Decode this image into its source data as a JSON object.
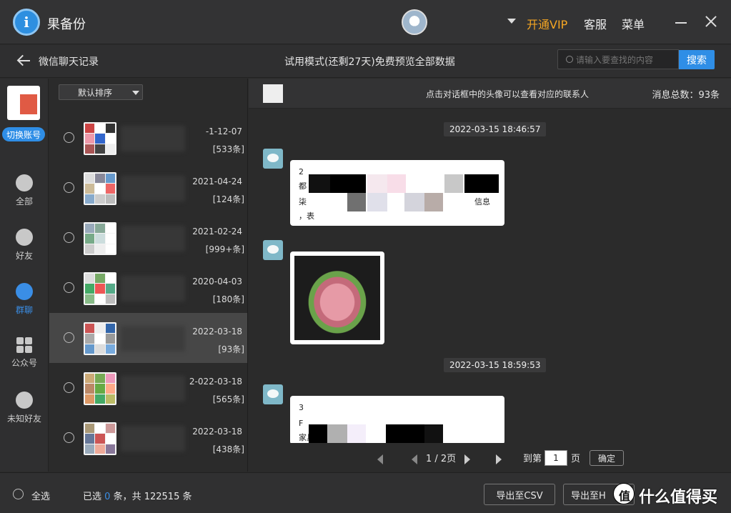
{
  "app": {
    "name": "果备份",
    "vip": "开通VIP",
    "service": "客服",
    "menu": "菜单"
  },
  "subbar": {
    "title": "微信聊天记录",
    "trial": "试用模式(还剩27天)免费预览全部数据",
    "search_placeholder": "请输入要查找的内容",
    "search_button": "搜索"
  },
  "leftnav": {
    "switch_label": "切换账号",
    "items": [
      {
        "label": "全部",
        "icon": "grid-icon"
      },
      {
        "label": "好友",
        "icon": "person-icon"
      },
      {
        "label": "群聊",
        "icon": "group-icon"
      },
      {
        "label": "公众号",
        "icon": "apps-icon"
      },
      {
        "label": "未知好友",
        "icon": "unknown-person-icon"
      }
    ],
    "active": "群聊"
  },
  "list": {
    "sort_label": "默认排序",
    "conversations": [
      {
        "date": "-1-12-07",
        "count": "[533条]"
      },
      {
        "date": "2021-04-24",
        "count": "[124条]"
      },
      {
        "date": "2021-02-24",
        "count": "[999+条]"
      },
      {
        "date": "2020-04-03",
        "count": "[180条]"
      },
      {
        "date": "2022-03-18",
        "count": "[93条]",
        "selected": true
      },
      {
        "date": "2-022-03-18",
        "count": "[565条]"
      },
      {
        "date": "2022-03-18",
        "count": "[438条]"
      }
    ]
  },
  "chat": {
    "hint": "点击对话框中的头像可以查看对应的联系人",
    "total": "消息总数：93条",
    "timestamps": [
      "2022-03-15 18:46:57",
      "2022-03-15 18:59:53"
    ],
    "msg1_fragments": [
      "2",
      "都",
      "柒",
      "，表",
      "信息"
    ],
    "msg3_fragments": [
      "3",
      "F",
      "家具"
    ]
  },
  "pager": {
    "page": "1 / 2页",
    "goto": "到第",
    "goto_value": "1",
    "page_unit": "页",
    "ok": "确定"
  },
  "bottom": {
    "select_all": "全选",
    "selected_prefix": "已选",
    "selected_count": "0",
    "selected_suffix": "条，共 122515 条",
    "export_csv": "导出至CSV",
    "export_html": "导出至H"
  },
  "watermark": {
    "text": "什么值得买"
  },
  "colors": {
    "accent": "#2f8ee6",
    "vip": "#f5a623",
    "bg": "#2b2b2b"
  }
}
